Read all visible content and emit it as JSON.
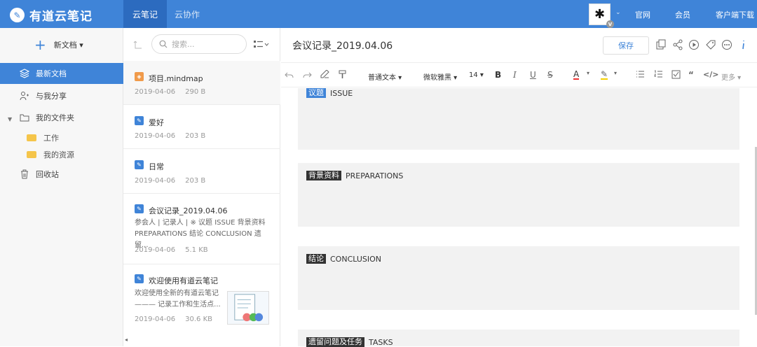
{
  "topbar": {
    "logo_icon": "✎",
    "app_title": "有道云笔记",
    "tab_active": "云笔记",
    "tab_collab": "云协作",
    "avatar_glyph": "✱",
    "avatar_badge": "V",
    "chevron": "⌄",
    "links": [
      "官网",
      "会员",
      "客户端下载"
    ]
  },
  "sidebar": {
    "new_doc": "新文档 ▾",
    "items": [
      "最新文档",
      "与我分享",
      "我的文件夹",
      "回收站"
    ],
    "folders": [
      "工作",
      "我的资源"
    ]
  },
  "list": {
    "search_placeholder": "搜索...",
    "notes": [
      {
        "title": "项目.mindmap",
        "date": "2019-04-06",
        "size": "290 B"
      },
      {
        "title": "爱好",
        "date": "2019-04-06",
        "size": "203 B"
      },
      {
        "title": "日常",
        "date": "2019-04-06",
        "size": "203 B"
      },
      {
        "title": "会议记录_2019.04.06",
        "snippet": "参会人 | 记录人 | ※ 议题 ISSUE 背景资料 PREPARATIONS 结论 CONCLUSION 遗留...",
        "date": "2019-04-06",
        "size": "5.1 KB"
      },
      {
        "title": "欢迎使用有道云笔记",
        "snippet": "欢迎使用全新的有道云笔记 ——— 记录工作和生活点...",
        "date": "2019-04-06",
        "size": "30.6 KB"
      }
    ]
  },
  "editor": {
    "title": "会议记录_2019.04.06",
    "save": "保存",
    "toolbar": {
      "para": "普通文本 ▾",
      "font": "微软雅黑 ▾",
      "size": "14 ▾",
      "more": "更多 ▾"
    },
    "sections": [
      {
        "tag": "议题",
        "label": "ISSUE"
      },
      {
        "tag": "背景资料",
        "label": "PREPARATIONS"
      },
      {
        "tag": "结论",
        "label": "CONCLUSION"
      },
      {
        "tag": "遗留问题及任务",
        "label": "TASKS"
      }
    ]
  },
  "colors": {
    "brand": "#3f84d8",
    "brand_dark": "#2c6bbf"
  }
}
